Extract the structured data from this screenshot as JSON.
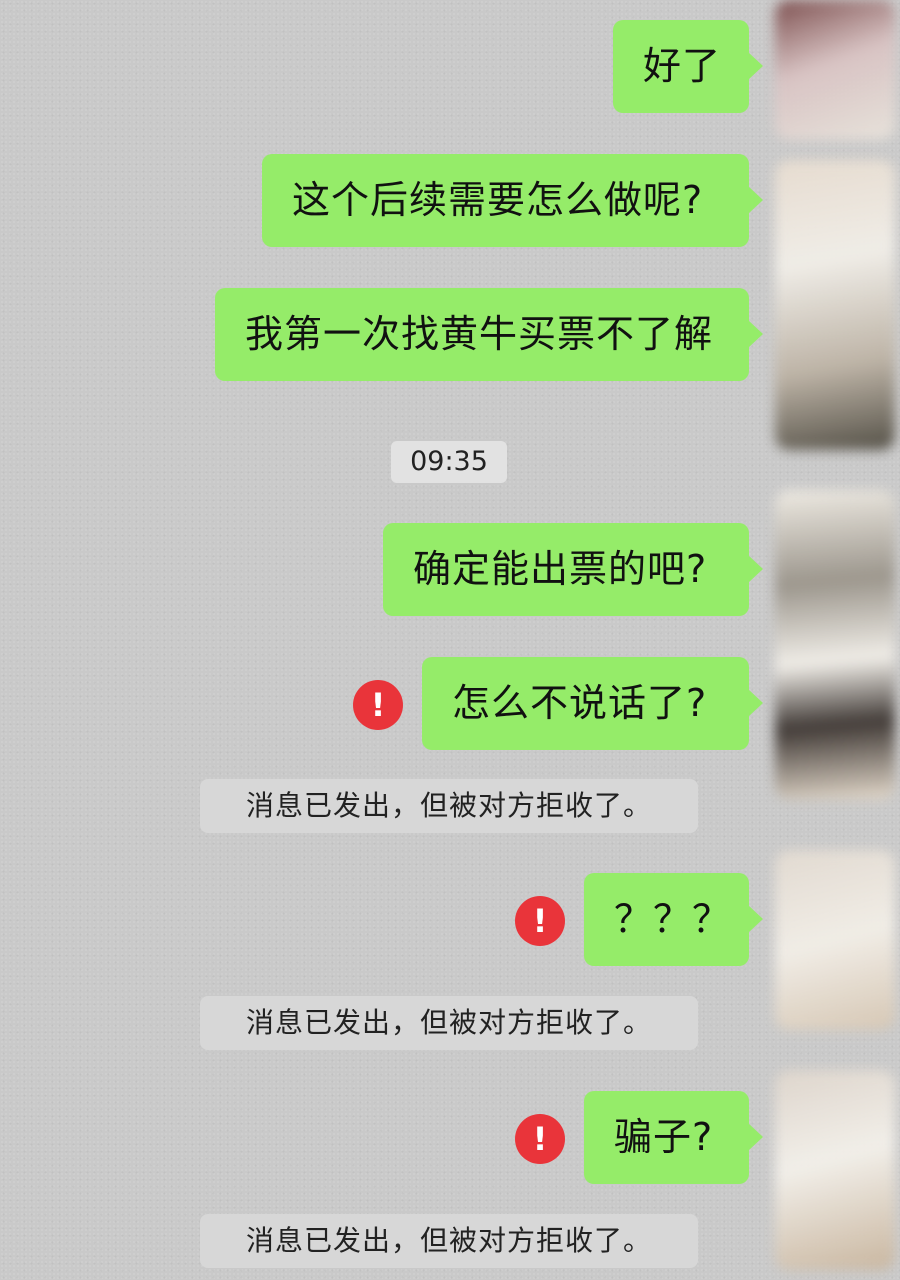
{
  "messages": [
    {
      "text": "好了",
      "status": "sent"
    },
    {
      "text": "这个后续需要怎么做呢?",
      "status": "sent"
    },
    {
      "text": "我第一次找黄牛买票不了解",
      "status": "sent"
    },
    {
      "text": "确定能出票的吧?",
      "status": "sent"
    },
    {
      "text": "怎么不说话了?",
      "status": "rejected"
    },
    {
      "text": "？？？",
      "status": "rejected"
    },
    {
      "text": "骗子?",
      "status": "rejected"
    }
  ],
  "timestamp": "09:35",
  "system_notice": "消息已发出，但被对方拒收了。",
  "icons": {
    "error": "exclamation-circle-icon",
    "error_glyph": "!"
  },
  "colors": {
    "bubble_green": "#95ec69",
    "error_red": "#e9343a",
    "background": "#c9c9c9"
  }
}
